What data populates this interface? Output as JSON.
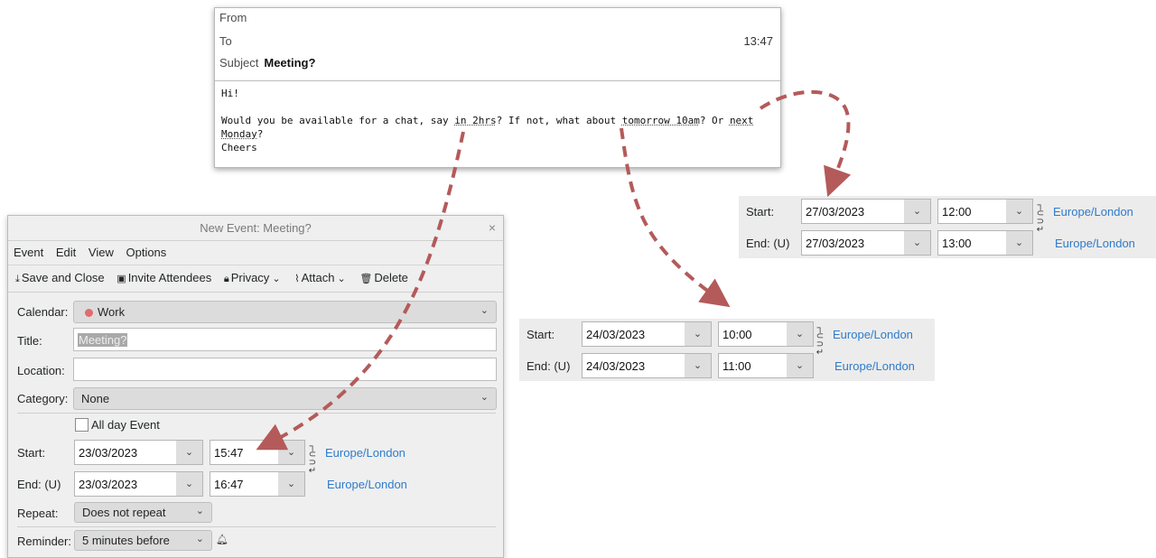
{
  "email": {
    "from_label": "From",
    "to_label": "To",
    "subject_label": "Subject",
    "subject_value": "Meeting?",
    "time": "13:47",
    "body": {
      "greeting": "Hi!",
      "line_a": "Would you be available for a chat, say ",
      "dt1": "in 2hrs",
      "line_b": "? If not, what about ",
      "dt2": "tomorrow 10am",
      "line_c": "? Or ",
      "dt3": "next Monday",
      "line_d": "?",
      "signoff": "Cheers"
    }
  },
  "event_window": {
    "title": "New Event: Meeting?",
    "close": "×",
    "menu": [
      "Event",
      "Edit",
      "View",
      "Options"
    ],
    "toolbar": {
      "save_close": "Save and Close",
      "invite": "Invite Attendees",
      "privacy": "Privacy",
      "attach": "Attach",
      "delete": "Delete"
    },
    "calendar_label": "Calendar:",
    "calendar_value": "Work",
    "calendar_color": "#e06c6c",
    "title_label": "Title:",
    "title_value": "Meeting?",
    "location_label": "Location:",
    "location_value": "",
    "category_label": "Category:",
    "category_value": "None",
    "all_day_label": "All day Event",
    "start_label": "Start:",
    "start_date": "23/03/2023",
    "start_time": "15:47",
    "end_label": "End: (U)",
    "end_date": "23/03/2023",
    "end_time": "16:47",
    "timezone_start": "Europe/London",
    "timezone_end": "Europe/London",
    "repeat_label": "Repeat:",
    "repeat_value": "Does not repeat",
    "reminder_label": "Reminder:",
    "reminder_value": "5 minutes before"
  },
  "panel_tomorrow": {
    "start_label": "Start:",
    "start_date": "24/03/2023",
    "start_time": "10:00",
    "end_label": "End: (U)",
    "end_date": "24/03/2023",
    "end_time": "11:00",
    "tz_start": "Europe/London",
    "tz_end": "Europe/London"
  },
  "panel_monday": {
    "start_label": "Start:",
    "start_date": "27/03/2023",
    "start_time": "12:00",
    "end_label": "End: (U)",
    "end_date": "27/03/2023",
    "end_time": "13:00",
    "tz_start": "Europe/London",
    "tz_end": "Europe/London"
  },
  "colors": {
    "arrow": "#b45a5a",
    "link": "#2f7bcb"
  },
  "icons": [
    "chevron-down-icon",
    "save-icon",
    "invite-icon",
    "lock-icon",
    "paperclip-icon",
    "trash-icon",
    "bell-icon",
    "chain-link-icon",
    "close-icon"
  ]
}
